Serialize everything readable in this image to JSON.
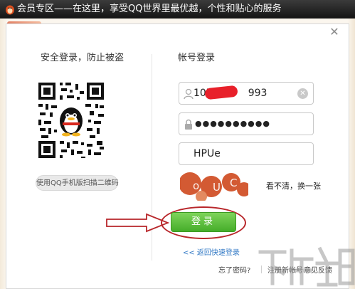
{
  "titlebar": {
    "title": "会员专区——在这里，享受QQ世界里最优越，个性和贴心的服务",
    "logo": "qq-penguin-icon"
  },
  "dialog": {
    "close_icon": "close-icon",
    "left_heading": "安全登录，防止被盗",
    "right_heading": "帐号登录",
    "qr_tip": "使用QQ手机版扫描二维码",
    "account": {
      "value": "107",
      "value_tail": "993",
      "icon": "user-icon",
      "clear_icon": "clear-icon"
    },
    "password": {
      "value": "●●●●●●●●●●",
      "icon": "lock-icon"
    },
    "captcha_input": {
      "value": "HPUe"
    },
    "captcha_refresh": "看不清，换一张",
    "login_button": "登录",
    "quick_login": "<< 返回快速登录",
    "forgot_password": "忘了密码?",
    "register": "注册新帐号",
    "feedback": "意见反馈"
  },
  "colors": {
    "titlebar": "#141414",
    "login_green": "#45ad2a",
    "link_blue": "#2f77c4",
    "annotation_red": "#b8262a"
  }
}
